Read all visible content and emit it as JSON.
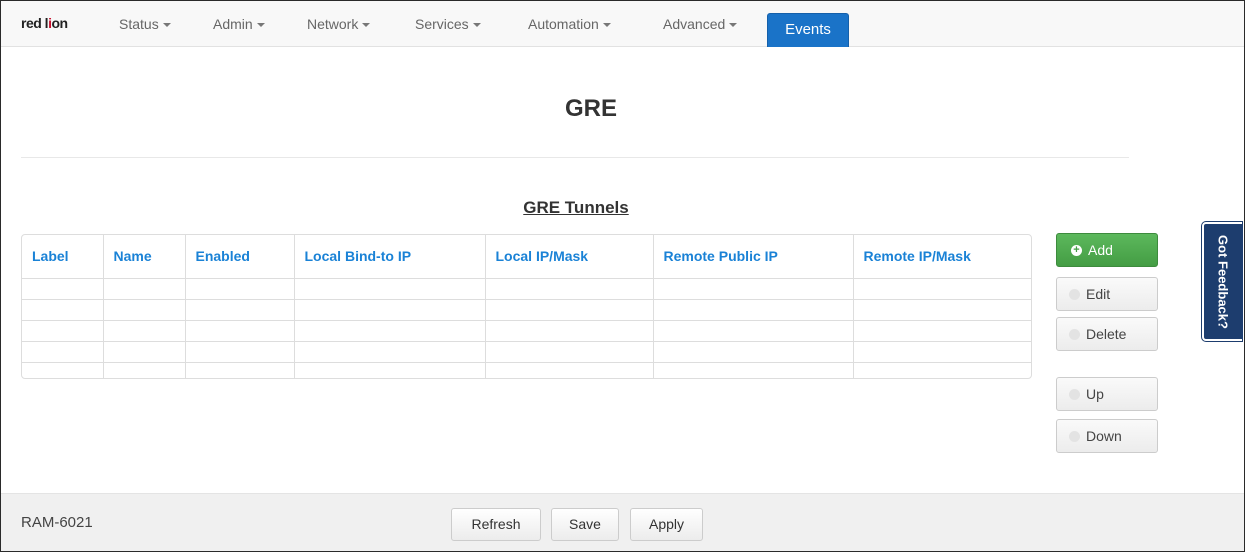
{
  "navbar": {
    "logo_text": "red lion",
    "logo_part1": "red l",
    "logo_mark": "i",
    "logo_part2": "on",
    "items": [
      {
        "label": "Status"
      },
      {
        "label": "Admin"
      },
      {
        "label": "Network"
      },
      {
        "label": "Services"
      },
      {
        "label": "Automation"
      },
      {
        "label": "Advanced"
      }
    ],
    "active_item": "Events",
    "active_color": "#1a73c8"
  },
  "page": {
    "title": "GRE",
    "section_title": "GRE Tunnels"
  },
  "table": {
    "columns": [
      "Label",
      "Name",
      "Enabled",
      "Local Bind-to IP",
      "Local IP/Mask",
      "Remote Public IP",
      "Remote IP/Mask"
    ],
    "rows": [
      [
        "",
        "",
        "",
        "",
        "",
        "",
        ""
      ],
      [
        "",
        "",
        "",
        "",
        "",
        "",
        ""
      ],
      [
        "",
        "",
        "",
        "",
        "",
        "",
        ""
      ],
      [
        "",
        "",
        "",
        "",
        "",
        "",
        ""
      ],
      [
        "",
        "",
        "",
        "",
        "",
        "",
        ""
      ]
    ],
    "header_color": "#1a82d6"
  },
  "actions": {
    "add": "Add",
    "edit": "Edit",
    "delete": "Delete",
    "up": "Up",
    "down": "Down",
    "add_color": "#5cb85c"
  },
  "feedback": {
    "label": "Got Feedback?",
    "color": "#1d3d6e"
  },
  "footer": {
    "model": "RAM-6021",
    "refresh": "Refresh",
    "save": "Save",
    "apply": "Apply"
  }
}
